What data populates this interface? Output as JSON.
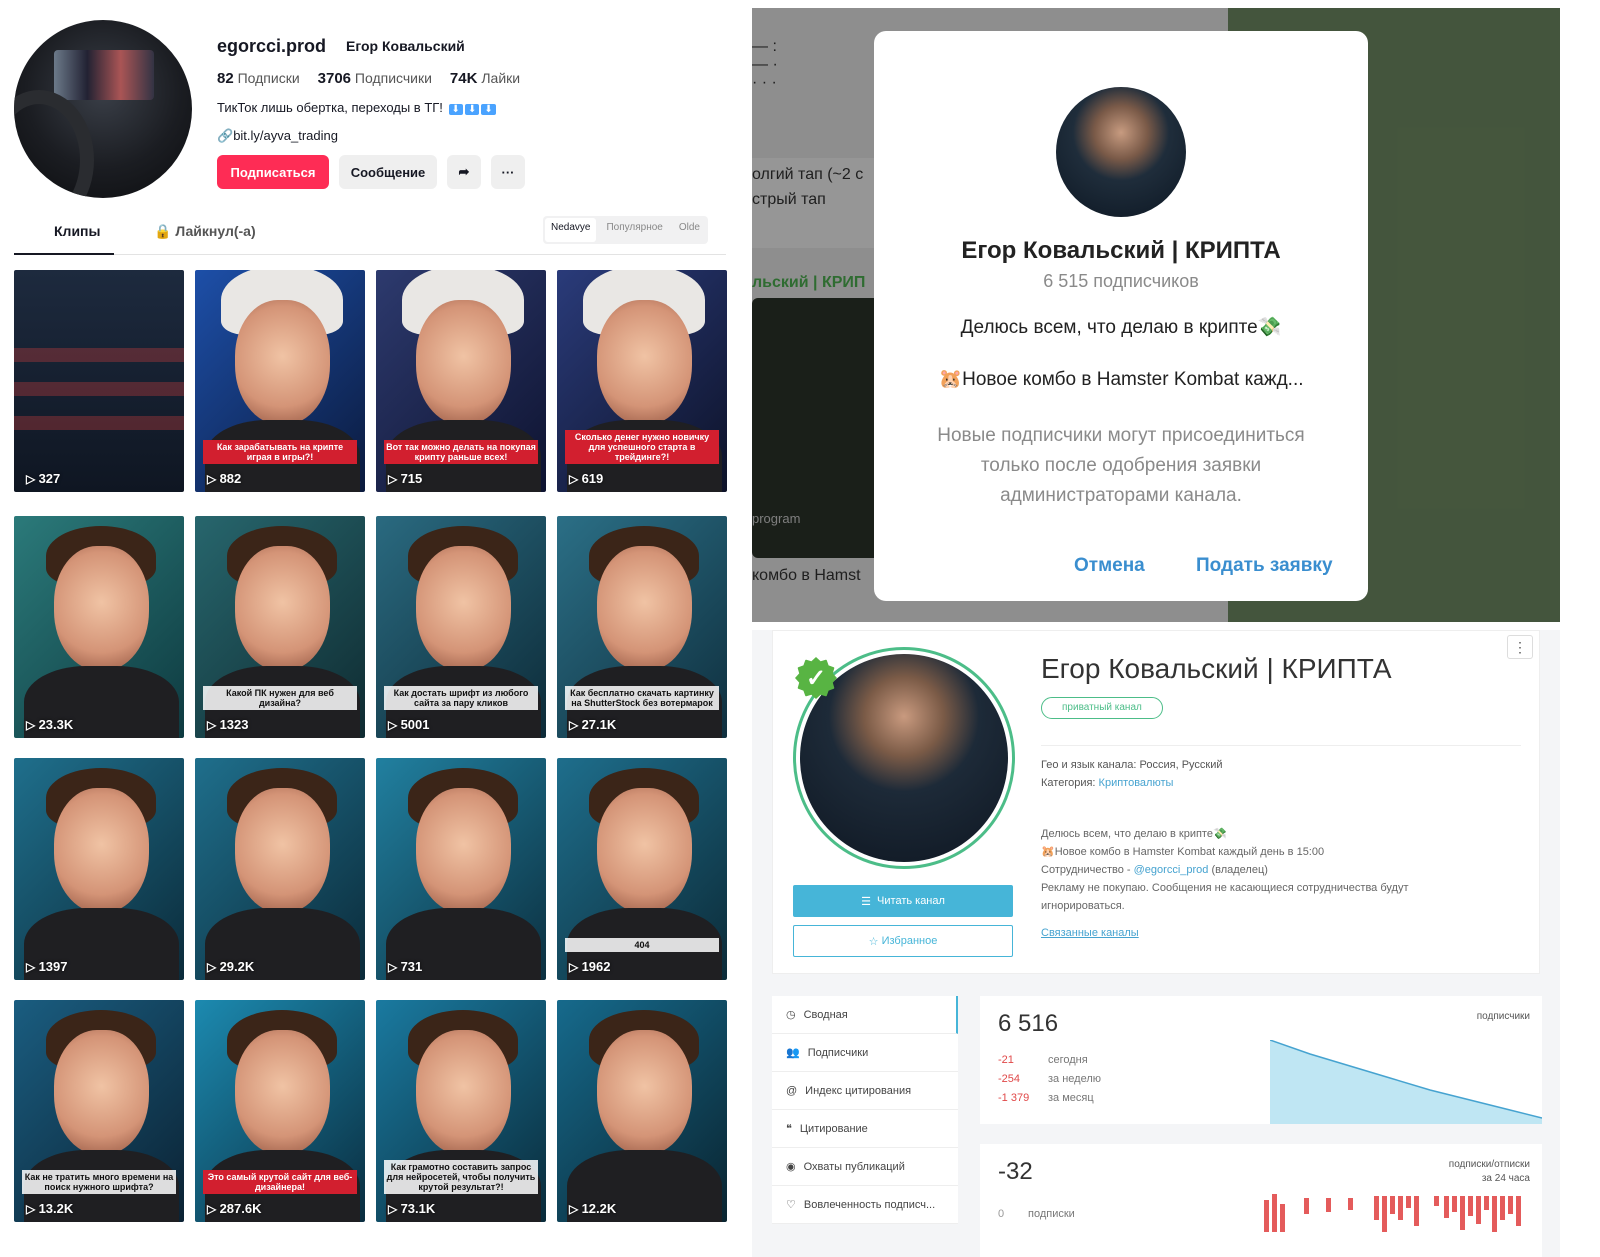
{
  "tiktok": {
    "username": "egorcci.prod",
    "display_name": "Егор Ковальский",
    "stats": [
      {
        "value": "82",
        "label": "Подписки"
      },
      {
        "value": "3706",
        "label": "Подписчики"
      },
      {
        "value": "74K",
        "label": "Лайки"
      }
    ],
    "bio": "ТикТок лишь обертка, переходы в ТГ!",
    "bio_arrows": [
      "⬇",
      "⬇",
      "⬇"
    ],
    "link": "bit.ly/ayva_trading",
    "follow_label": "Подписаться",
    "message_label": "Сообщение",
    "tabs": {
      "clips": "Клипы",
      "liked": "Лайкнул(-а)"
    },
    "sort": {
      "latest": "Nedavye",
      "popular": "Популярное",
      "oldest": "Olde"
    },
    "videos": [
      {
        "views": "327",
        "caption": ""
      },
      {
        "views": "882",
        "caption": "Как зарабатывать на крипте играя в игры?!"
      },
      {
        "views": "715",
        "caption": "Вот так можно делать на покупая крипту раньше всех!"
      },
      {
        "views": "619",
        "caption": "Сколько денег нужно новичку для успешного старта в трейдинге?!"
      },
      {
        "views": "23.3K",
        "caption": ""
      },
      {
        "views": "1323",
        "caption": "Какой ПК нужен для веб дизайна?"
      },
      {
        "views": "5001",
        "caption": "Как достать шрифт из любого сайта за пару кликов"
      },
      {
        "views": "27.1K",
        "caption": "Как бесплатно скачать картинку на ShutterStock без вотермарок"
      },
      {
        "views": "1397",
        "caption": ""
      },
      {
        "views": "29.2K",
        "caption": ""
      },
      {
        "views": "731",
        "caption": ""
      },
      {
        "views": "1962",
        "caption": "404"
      },
      {
        "views": "13.2K",
        "caption": "Как не тратить много времени на поиск нужного шрифта?"
      },
      {
        "views": "287.6K",
        "caption": "Это самый крутой сайт для веб-дизайнера!"
      },
      {
        "views": "73.1K",
        "caption": "Как грамотно составить запрос для нейросетей, чтобы получить крутой результат?!"
      },
      {
        "views": "12.2K",
        "caption": ""
      }
    ]
  },
  "telegram": {
    "bg_items": [
      "олгий тап (~2 с",
      "стрый тап",
      "льский | КРИП",
      "program",
      "комбо в Hamst"
    ],
    "title": "Егор Ковальский | КРИПТА",
    "subscribers": "6 515 подписчиков",
    "desc1": "Делюсь всем, что делаю в крипте💸",
    "desc2": "🐹Новое комбо в Hamster Kombat кажд...",
    "note": "Новые подписчики могут присоединиться только после одобрения заявки администраторами канала.",
    "cancel": "Отмена",
    "apply": "Подать заявку"
  },
  "tgstat": {
    "title": "Егор Ковальский | КРИПТА",
    "private_badge": "приватный канал",
    "geo_label": "Гео и язык канала:",
    "geo_value": "Россия, Русский",
    "category_label": "Категория:",
    "category_value": "Криптовалюты",
    "about": [
      "Делюсь всем, что делаю в крипте💸",
      "🐹Новое комбо в Hamster Kombat каждый день в 15:00"
    ],
    "coop_prefix": "Сотрудничество -",
    "coop_handle": "@egorcci_prod",
    "coop_suffix": "(владелец)",
    "about_last": "Рекламу не покупаю. Сообщения не касающиеся сотрудничества будут игнорироваться.",
    "related": "Связанные каналы",
    "read_btn": "Читать канал",
    "fav_btn": "Избранное",
    "menu": [
      "Сводная",
      "Подписчики",
      "Индекс цитирования",
      "Цитирование",
      "Охваты публикаций",
      "Вовлеченность подписч..."
    ],
    "subs_total": "6 516",
    "subs_label": "подписчики",
    "deltas": [
      {
        "n": "-21",
        "t": "сегодня"
      },
      {
        "n": "-254",
        "t": "за неделю"
      },
      {
        "n": "-1 379",
        "t": "за месяц"
      }
    ],
    "net": "-32",
    "net_label1": "подписки/отписки",
    "net_label2": "за 24 часа",
    "net_row": {
      "n": "0",
      "t": "подписки"
    },
    "accent": "#46b5d8"
  }
}
